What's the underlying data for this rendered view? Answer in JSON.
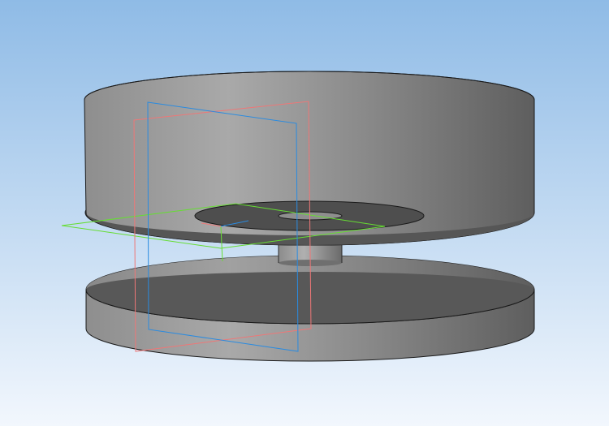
{
  "viewport": {
    "background_top": "#8fbbe6",
    "background_bottom": "#f2f7fd"
  },
  "model": {
    "body_color": "#8a8a8a",
    "shadow_color": "#565656",
    "edge_color": "#1a1a1a"
  },
  "planes": {
    "xy_color": "#66dd33",
    "zy_color": "#ee7777",
    "xz_color": "#2a8be0"
  },
  "origin": {
    "axis_color": "#2a8be0"
  }
}
